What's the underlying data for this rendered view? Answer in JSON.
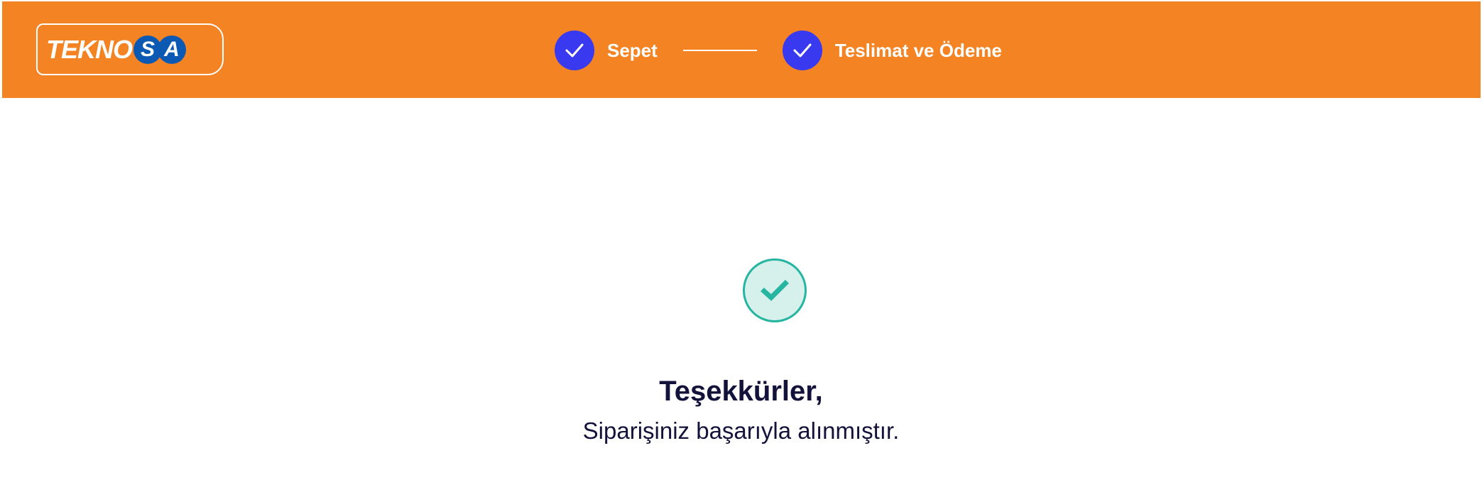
{
  "header": {
    "logo_text": "TEKNO",
    "logo_badges": [
      "S",
      "A"
    ],
    "background_color": "#f48323"
  },
  "steps": [
    {
      "label": "Sepet",
      "status": "completed",
      "icon": "check-icon"
    },
    {
      "label": "Teslimat ve Ödeme",
      "status": "completed",
      "icon": "check-icon"
    }
  ],
  "confirmation": {
    "icon": "check-circle-icon",
    "title": "Teşekkürler,",
    "message": "Siparişiniz başarıyla alınmıştır."
  },
  "colors": {
    "brand_orange": "#f48323",
    "step_blue": "#3939f0",
    "success_green": "#25b5a0",
    "text_dark": "#13123a"
  }
}
